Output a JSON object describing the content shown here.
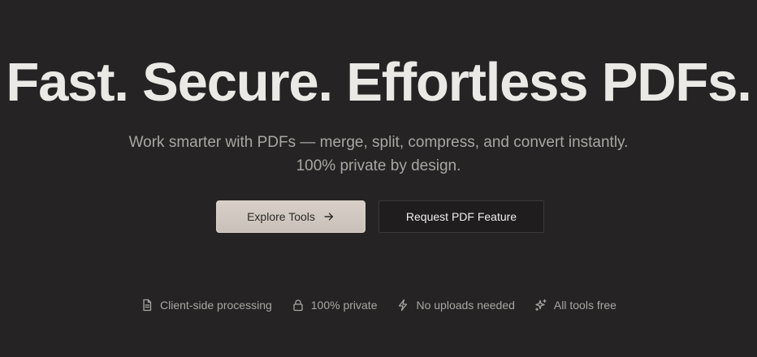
{
  "hero": {
    "headline": "Fast. Secure. Effortless PDFs.",
    "subtitle_line1": "Work smarter with PDFs — merge, split, compress, and convert instantly.",
    "subtitle_line2": "100% private by design."
  },
  "actions": {
    "primary_label": "Explore Tools",
    "primary_icon": "arrow-right-icon",
    "secondary_label": "Request PDF Feature"
  },
  "features": [
    {
      "label": "Client-side processing",
      "icon": "document-icon"
    },
    {
      "label": "100% private",
      "icon": "lock-icon"
    },
    {
      "label": "No uploads needed",
      "icon": "lightning-icon"
    },
    {
      "label": "All tools free",
      "icon": "sparkles-icon"
    }
  ],
  "colors": {
    "background": "#252324",
    "headline": "#ebe9e6",
    "muted_text": "#a9a6a3",
    "primary_button": "#d2cac2",
    "secondary_button": "#1f1d1e"
  }
}
